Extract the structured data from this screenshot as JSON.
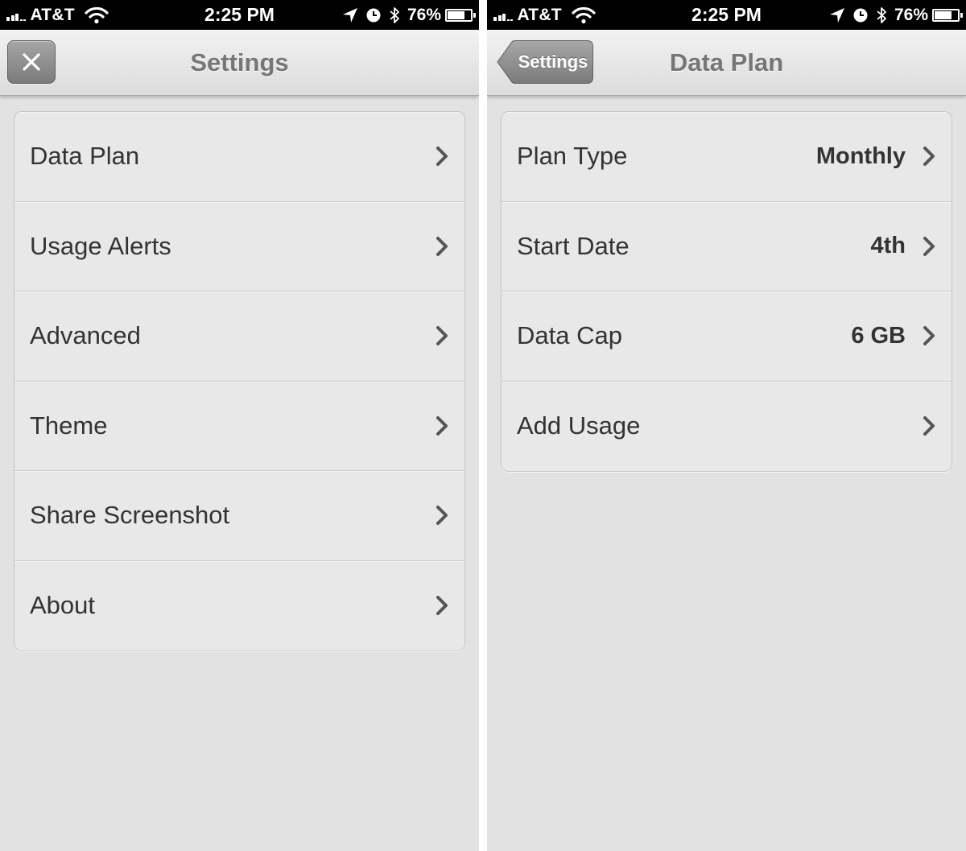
{
  "status_bar": {
    "carrier": "AT&T",
    "time": "2:25 PM",
    "battery_percent": "76%",
    "battery_level": 0.76,
    "icons": [
      "signal-icon",
      "wifi-icon",
      "location-arrow-icon",
      "alarm-clock-icon",
      "bluetooth-icon",
      "battery-icon"
    ]
  },
  "settings_screen": {
    "title": "Settings",
    "close_icon": "close-icon",
    "items": [
      {
        "label": "Data Plan"
      },
      {
        "label": "Usage Alerts"
      },
      {
        "label": "Advanced"
      },
      {
        "label": "Theme"
      },
      {
        "label": "Share Screenshot"
      },
      {
        "label": "About"
      }
    ]
  },
  "data_plan_screen": {
    "title": "Data Plan",
    "back_label": "Settings",
    "items": [
      {
        "label": "Plan Type",
        "value": "Monthly"
      },
      {
        "label": "Start Date",
        "value": "4th"
      },
      {
        "label": "Data Cap",
        "value": "6 GB"
      },
      {
        "label": "Add Usage",
        "value": ""
      }
    ]
  },
  "colors": {
    "screen_bg": "#e2e2e2",
    "row_bg": "#e8e8e8",
    "title_text": "#767676",
    "row_text": "#333333",
    "chevron": "#555555",
    "button_dark": "#7b7b7b"
  }
}
